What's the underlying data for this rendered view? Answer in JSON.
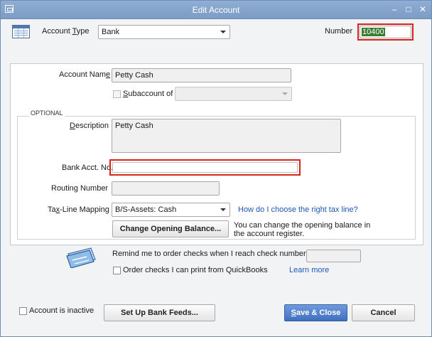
{
  "window": {
    "title": "Edit Account"
  },
  "controls": {
    "minimize": "–",
    "maximize": "□",
    "close": "✕"
  },
  "account_type": {
    "label_pre": "Account ",
    "label_u": "T",
    "label_post": "ype",
    "value": "Bank"
  },
  "number": {
    "label": "Number",
    "value": "10400"
  },
  "account_name": {
    "label_pre": "Account Nam",
    "label_u": "e",
    "value": "Petty Cash"
  },
  "subaccount": {
    "label_u": "S",
    "label_post": "ubaccount of",
    "value": ""
  },
  "optional": {
    "legend": "OPTIONAL"
  },
  "description": {
    "label_u": "D",
    "label_post": "escription",
    "value": "Petty Cash"
  },
  "bank_acct": {
    "label": "Bank Acct. No.",
    "value": ""
  },
  "routing": {
    "label": "Routing Number",
    "value": ""
  },
  "tax_line": {
    "label_pre": "Ta",
    "label_u": "x",
    "label_post": "-Line Mapping",
    "value": "B/S-Assets: Cash",
    "help_link": "How do I choose the right tax line?"
  },
  "opening_balance": {
    "button": "Change Opening Balance...",
    "note_line1": "You can change the opening balance in",
    "note_line2": "the account register."
  },
  "checks": {
    "remind_label": "Remind me to order checks when I reach check number",
    "remind_value": "",
    "order_label": "Order checks I can print from QuickBooks",
    "learn_more": "Learn more"
  },
  "footer": {
    "inactive_label": "Account is inactive",
    "bank_feeds": "Set Up Bank Feeds...",
    "save_close_u": "S",
    "save_close_rest": "ave & Close",
    "cancel": "Cancel"
  },
  "colors": {
    "titlebar": "#7c9cc6",
    "highlight": "#d9231b",
    "number_bg": "#3a7d2e",
    "link": "#1b57b8"
  }
}
